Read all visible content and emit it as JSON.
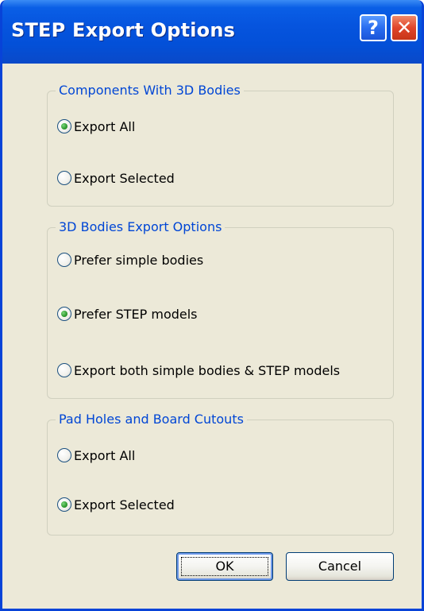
{
  "window": {
    "title": "STEP Export Options",
    "title_bar_color": "#0a5fe6",
    "frame_color": "#ece9d8",
    "help_label": "?",
    "close_label": "✕"
  },
  "groups": [
    {
      "title": "Components With 3D Bodies",
      "options": [
        {
          "label": "Export All",
          "checked": true
        },
        {
          "label": "Export Selected",
          "checked": false
        }
      ]
    },
    {
      "title": "3D Bodies Export Options",
      "options": [
        {
          "label": "Prefer simple bodies",
          "checked": false
        },
        {
          "label": "Prefer STEP models",
          "checked": true
        },
        {
          "label": "Export both simple bodies & STEP models",
          "checked": false
        }
      ]
    },
    {
      "title": "Pad Holes and Board Cutouts",
      "options": [
        {
          "label": "Export All",
          "checked": false
        },
        {
          "label": "Export Selected",
          "checked": true
        }
      ]
    }
  ],
  "buttons": {
    "ok_label": "OK",
    "cancel_label": "Cancel"
  },
  "colors": {
    "group_title": "#0046d5",
    "radio_dot": "#2f9a2f"
  }
}
